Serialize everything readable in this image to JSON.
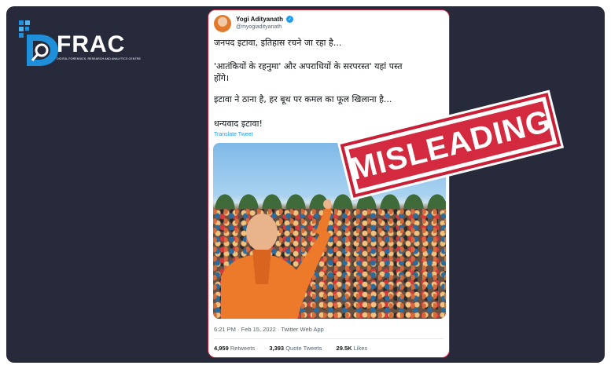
{
  "logo": {
    "text": "FRAC",
    "tagline": "DIGITAL FORENSICS, RESEARCH AND ANALYTICS CENTRE"
  },
  "tweet": {
    "author_name": "Yogi Adityanath",
    "handle": "@myogiadityanath",
    "lines": [
      "जनपद इटावा, इतिहास रचने जा रहा है...",
      "'आतंकियों के रहनुमा' और अपराधियों के सरपरस्त' यहां पस्त",
      "होंगे।",
      "इटावा ने ठाना है, हर बूथ पर कमल का फूल खिलाना है...",
      "धन्यवाद इटावा!"
    ],
    "translate_label": "Translate Tweet",
    "timestamp": "6:21 PM · Feb 15, 2022 · Twitter Web App",
    "retweets_count": "4,959",
    "retweets_label": "Retweets",
    "quotes_count": "3,393",
    "quotes_label": "Quote Tweets",
    "likes_count": "29.5K",
    "likes_label": "Likes"
  },
  "stamp": {
    "text": "MISLEADING"
  },
  "colors": {
    "background": "#262a3a",
    "stamp_red": "#d42a3f",
    "logo_blue": "#1e8fd8",
    "twitter_blue": "#1d9bf0"
  }
}
